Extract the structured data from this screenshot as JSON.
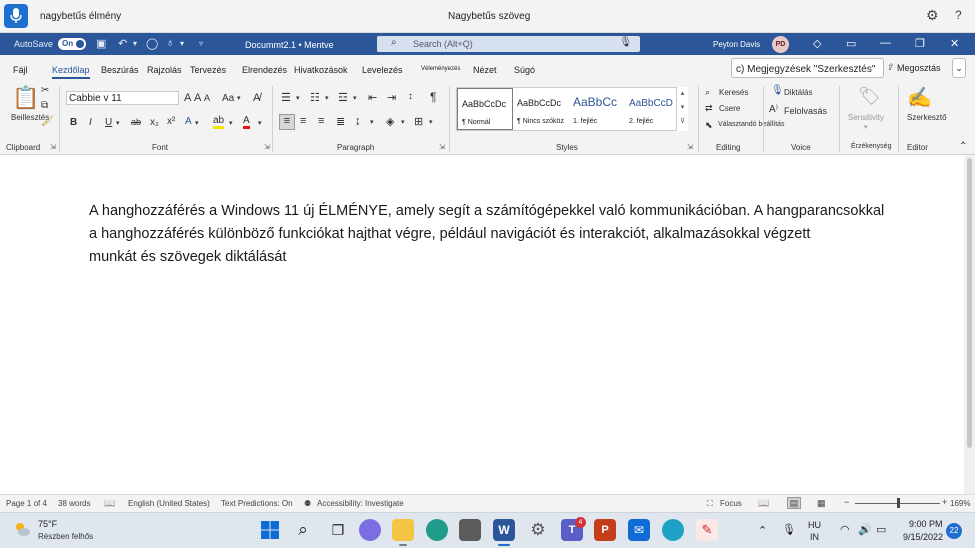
{
  "voice_bar": {
    "status_text": "nagybetűs élmény",
    "command_text": "Nagybetűs szöveg"
  },
  "title_bar": {
    "autosave_label": "AutoSave",
    "autosave_state": "On",
    "document_title": "Docummt2.1 • Mentve",
    "search_placeholder": "Search (Alt+Q)",
    "user_name": "Peyton Davis",
    "user_initials": "PD"
  },
  "ribbon_tabs": {
    "items": [
      "Fájl",
      "Kezdőlap",
      "Beszúrás",
      "Rajzolás",
      "Tervezés",
      "Elrendezés",
      "Hivatkozások",
      "Levelezés",
      "Véleményezés",
      "Nézet",
      "Súgó"
    ],
    "active": "Kezdőlap",
    "comments_button": "c) Megjegyzések \"Szerkesztés\"",
    "share_button": "Megosztás"
  },
  "ribbon": {
    "clipboard": {
      "paste_label": "Beillesztés",
      "group_label": "Clipboard"
    },
    "font": {
      "font_name": "Cabbie v 11",
      "group_label": "Font",
      "bold": "B",
      "italic": "I",
      "underline": "U",
      "strike": "ab",
      "subscript": "x₂",
      "superscript": "x²",
      "grow": "A",
      "shrink": "A",
      "case": "Aa",
      "highlight": "ab",
      "color": "A"
    },
    "paragraph": {
      "group_label": "Paragraph"
    },
    "styles": {
      "group_label": "Styles",
      "items": [
        {
          "preview": "AaBbCcDc",
          "name": "¶ Normál"
        },
        {
          "preview": "AaBbCcDc",
          "name": "¶ Nincs szóköz"
        },
        {
          "preview": "AaBbCc",
          "name": "1. fejléc"
        },
        {
          "preview": "AaBbCcD",
          "name": "2. fejléc"
        }
      ]
    },
    "editing": {
      "group_label": "Editing",
      "find": "Keresés",
      "replace": "Csere",
      "select": "Választandó beállítás"
    },
    "voice": {
      "group_label": "Voice",
      "dictate": "Diktálás",
      "read_aloud": "Felolvasás"
    },
    "sensitivity": {
      "label": "Sensitivity",
      "group_label": "Érzékenység"
    },
    "editor": {
      "label": "Szerkesztő",
      "group_label": "Editor"
    }
  },
  "document": {
    "lines": [
      "A hanghozzáférés a Windows 11 új ÉLMÉNYE, amely segít a számítógépekkel való kommunikációban. A hangparancsokkal",
      "a hanghozzáférés különböző funkciókat hajthat végre, például navigációt és interakciót, alkalmazásokkal végzett",
      "munkát és szövegek diktálását"
    ]
  },
  "status_bar": {
    "page": "Page 1 of 4",
    "words": "38 words",
    "language": "English (United States)",
    "predictions": "Text Predictions: On",
    "accessibility": "Accessibility: Investigate",
    "focus": "Focus",
    "zoom_percent": "169%",
    "zoom_level": 0.5
  },
  "taskbar": {
    "temperature": "75°F",
    "weather": "Részben felhős",
    "teams_badge": "4",
    "language_top": "HU",
    "language_bottom": "IN",
    "time": "9:00 PM",
    "date": "9/15/2022",
    "notifications": "22"
  },
  "colors": {
    "word_blue": "#2b579a",
    "voice_blue": "#1f6fd1"
  }
}
